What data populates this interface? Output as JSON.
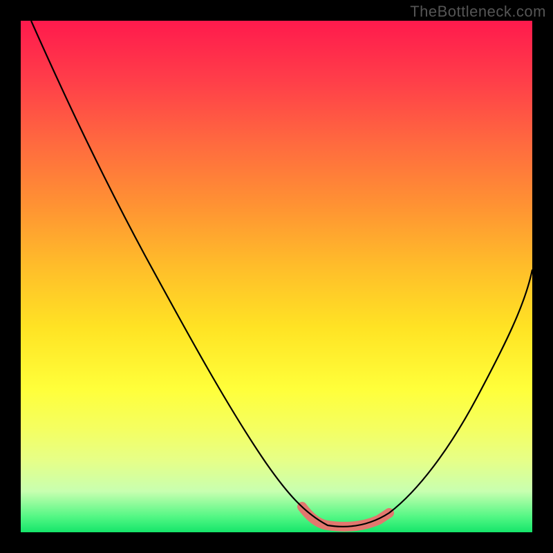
{
  "watermark": "TheBottleneck.com",
  "colors": {
    "background": "#000000",
    "gradient_top": "#ff1a4d",
    "gradient_bottom": "#15e56a",
    "curve": "#000000",
    "highlight": "#e2776e",
    "watermark_text": "#555555"
  },
  "chart_data": {
    "type": "line",
    "title": "",
    "xlabel": "",
    "ylabel": "",
    "xlim": [
      0,
      100
    ],
    "ylim": [
      0,
      100
    ],
    "grid": false,
    "legend": false,
    "background": "heatmap-gradient vertical red-to-green",
    "series": [
      {
        "name": "bottleneck-curve",
        "x": [
          2,
          10,
          20,
          30,
          40,
          48,
          53,
          57,
          60,
          65,
          70,
          80,
          90,
          100
        ],
        "y": [
          100,
          85,
          68,
          50,
          32,
          17,
          8,
          3,
          1,
          1,
          3,
          15,
          32,
          52
        ]
      }
    ],
    "highlighted_segment": {
      "series": "bottleneck-curve",
      "x_range": [
        55,
        72
      ],
      "description": "optimal-zone marker near curve minimum"
    },
    "annotations": [
      {
        "type": "watermark",
        "text": "TheBottleneck.com",
        "position": "top-right"
      }
    ]
  }
}
